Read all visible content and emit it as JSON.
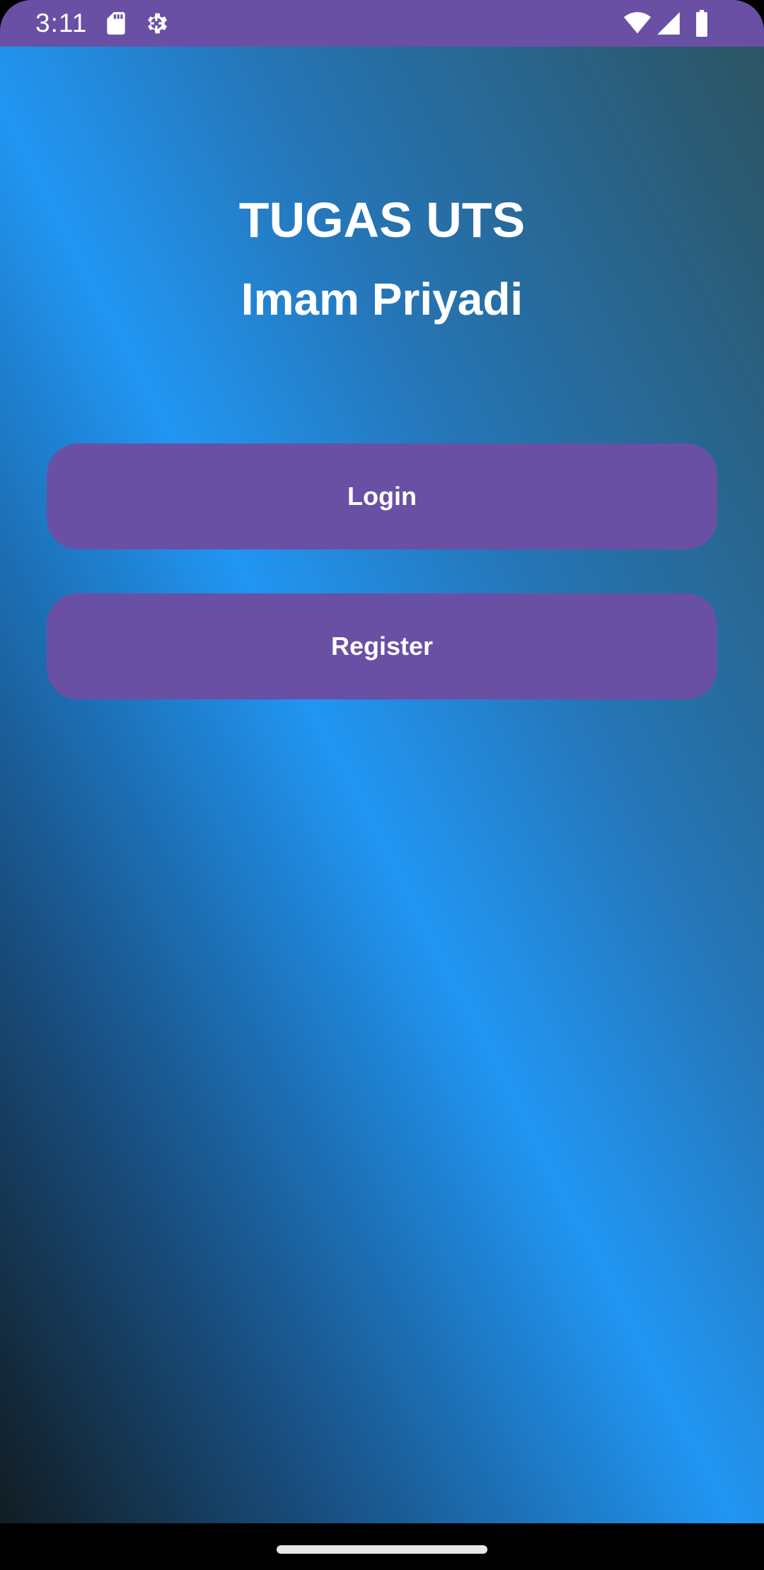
{
  "status_bar": {
    "time": "3:11",
    "background_color": "#6950a5",
    "icons": [
      "sd-card-icon",
      "settings-gear-icon",
      "wifi-icon",
      "cellular-signal-icon",
      "battery-icon"
    ]
  },
  "main": {
    "title": "TUGAS UTS",
    "subtitle": "Imam Priyadi",
    "buttons": {
      "login_label": "Login",
      "register_label": "Register"
    },
    "button_color": "#6950a5",
    "gradient_colors": [
      "#111c22",
      "#195083",
      "#2196f3",
      "#2576b8",
      "#2c5463"
    ]
  },
  "navigation_bar": {
    "background_color": "#000000",
    "home_indicator": "home-gesture-pill"
  }
}
